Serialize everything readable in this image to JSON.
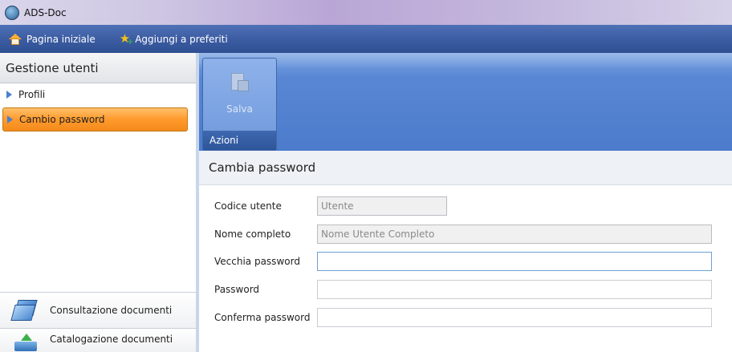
{
  "window": {
    "title": "ADS-Doc"
  },
  "navbar": {
    "home_label": "Pagina iniziale",
    "favorites_label": "Aggiungi a preferiti"
  },
  "sidebar": {
    "title": "Gestione utenti",
    "items": [
      {
        "label": "Profili",
        "selected": false
      },
      {
        "label": "Cambio password",
        "selected": true
      }
    ],
    "bottom_items": [
      {
        "label": "Consultazione documenti"
      },
      {
        "label": "Catalogazione documenti"
      }
    ]
  },
  "ribbon": {
    "save_label": "Salva",
    "group_label": "Azioni"
  },
  "form": {
    "title": "Cambia password",
    "fields": [
      {
        "label": "Codice utente",
        "value": "Utente",
        "disabled": true
      },
      {
        "label": "Nome completo",
        "value": "Nome Utente Completo",
        "disabled": true
      },
      {
        "label": "Vecchia password",
        "value": "",
        "disabled": false
      },
      {
        "label": "Password",
        "value": "",
        "disabled": false
      },
      {
        "label": "Conferma password",
        "value": "",
        "disabled": false
      }
    ]
  }
}
